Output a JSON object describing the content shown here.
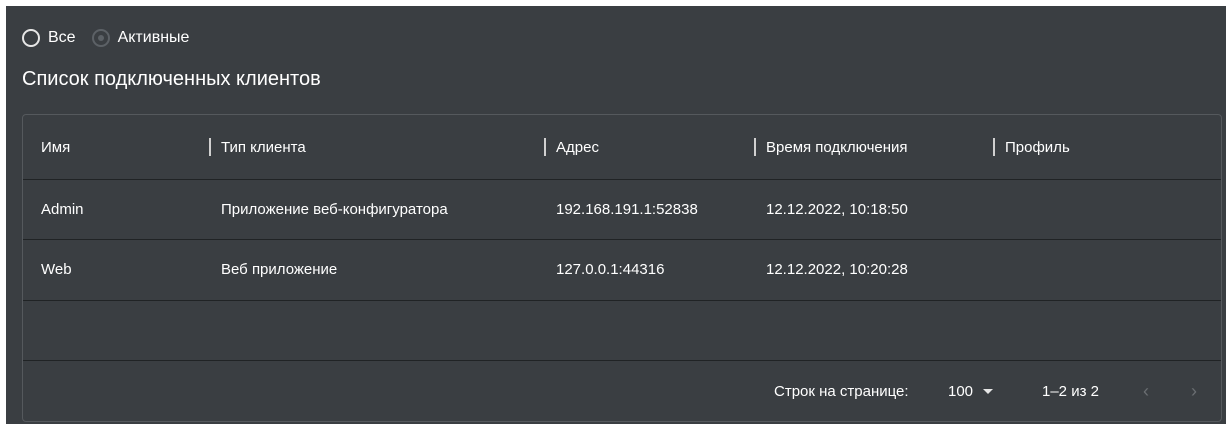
{
  "filter": {
    "options": [
      {
        "label": "Все",
        "state": "unselected"
      },
      {
        "label": "Активные",
        "state": "disabled"
      }
    ]
  },
  "title": "Список подключенных клиентов",
  "table": {
    "columns": [
      "Имя",
      "Тип клиента",
      "Адрес",
      "Время подключения",
      "Профиль"
    ],
    "rows": [
      [
        "Admin",
        "Приложение веб-конфигуратора",
        "192.168.191.1:52838",
        "12.12.2022, 10:18:50",
        ""
      ],
      [
        "Web",
        "Веб приложение",
        "127.0.0.1:44316",
        "12.12.2022, 10:20:28",
        ""
      ]
    ]
  },
  "pagination": {
    "rows_per_page_label": "Строк на странице:",
    "rows_per_page_value": "100",
    "range": "1–2 из 2",
    "prev_icon": "‹",
    "next_icon": "›"
  },
  "colors": {
    "background": "#3a3e42",
    "border": "#55595d",
    "text": "#ffffff",
    "disabled": "#6a6e72"
  }
}
